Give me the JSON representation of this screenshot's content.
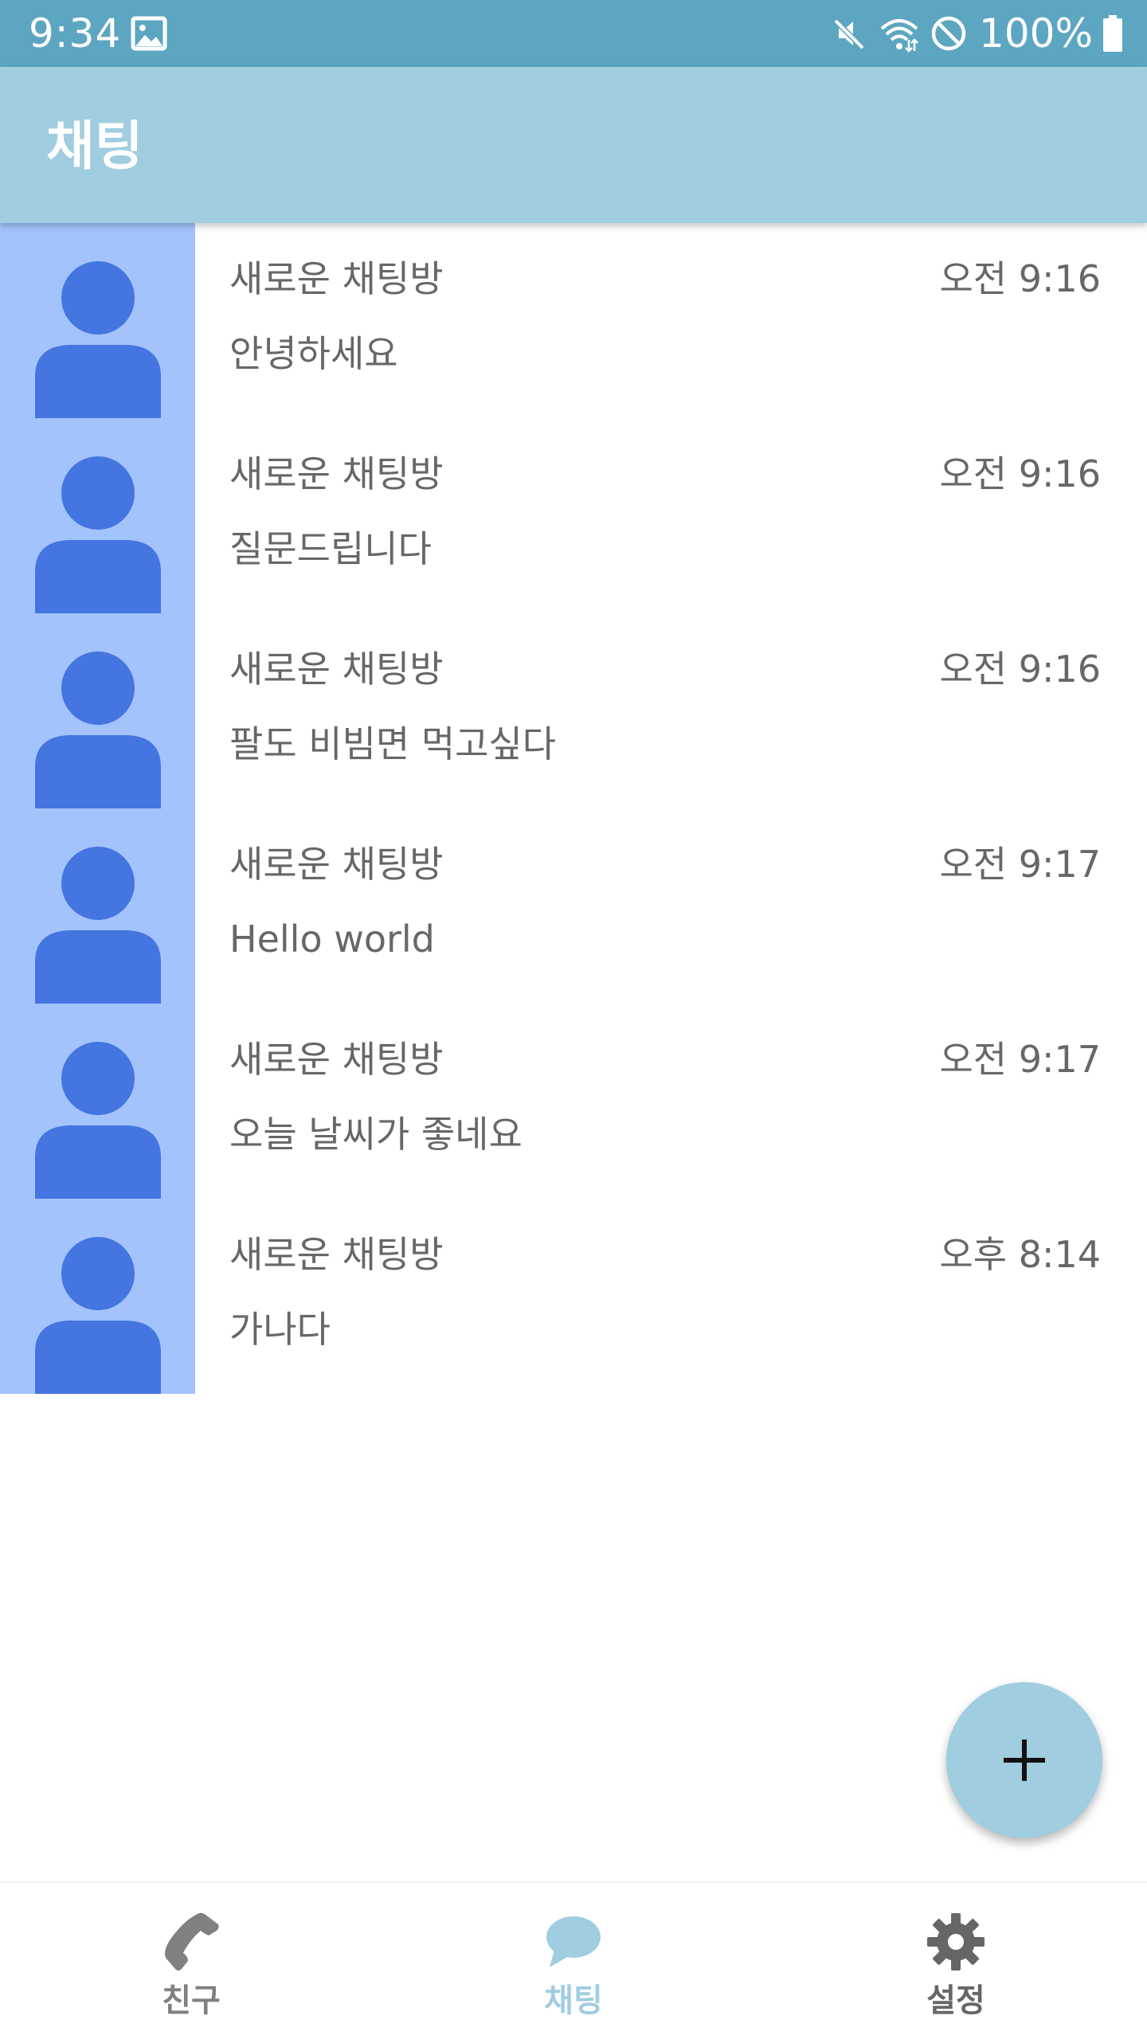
{
  "status_bar": {
    "time": "9:34",
    "battery_text": "100%",
    "icons": [
      "image-icon",
      "mute-icon",
      "wifi-icon",
      "do-not-disturb-icon",
      "battery-icon"
    ]
  },
  "app_bar": {
    "title": "채팅"
  },
  "chats": [
    {
      "title": "새로운 채팅방",
      "time": "오전 9:16",
      "message": "안녕하세요"
    },
    {
      "title": "새로운 채팅방",
      "time": "오전 9:16",
      "message": "질문드립니다"
    },
    {
      "title": "새로운 채팅방",
      "time": "오전 9:16",
      "message": "팔도 비빔면 먹고싶다"
    },
    {
      "title": "새로운 채팅방",
      "time": "오전 9:17",
      "message": "Hello world"
    },
    {
      "title": "새로운 채팅방",
      "time": "오전 9:17",
      "message": "오늘 날씨가 좋네요"
    },
    {
      "title": "새로운 채팅방",
      "time": "오후 8:14",
      "message": "가나다"
    }
  ],
  "fab": {
    "icon": "plus-icon"
  },
  "bottom_nav": {
    "items": [
      {
        "label": "친구",
        "icon": "phone-icon",
        "color": "#808080"
      },
      {
        "label": "채팅",
        "icon": "chat-bubble-icon",
        "color": "#a0cde0"
      },
      {
        "label": "설정",
        "icon": "gear-icon",
        "color": "#666666"
      }
    ],
    "selected": 1
  },
  "colors": {
    "status_bar": "#5da6c1",
    "app_bar": "#a0cde0",
    "avatar_bg": "#a3c3fc",
    "avatar_figure": "#4475e0",
    "text": "#676767"
  }
}
